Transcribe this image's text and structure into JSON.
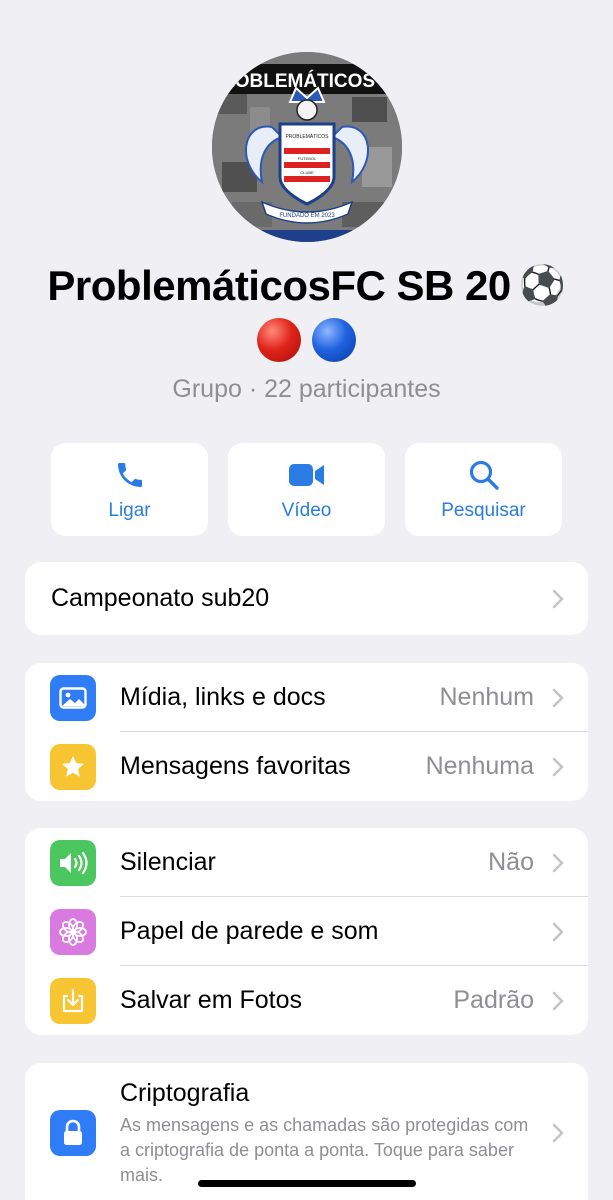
{
  "profile": {
    "name": "ProblemáticosFC SB 20",
    "name_emoji": "⚽",
    "subtitle": "Grupo · 22 participantes",
    "crest_texts": [
      "PROBLEMÁTICOS FC",
      "PROBLEMÁTICOS",
      "FUTEBOL",
      "CLUBE",
      "FUNDADO EM 2023"
    ]
  },
  "actions": [
    {
      "label": "Ligar",
      "icon": "phone-icon"
    },
    {
      "label": "Vídeo",
      "icon": "video-icon"
    },
    {
      "label": "Pesquisar",
      "icon": "search-icon"
    }
  ],
  "description": {
    "text": "Campeonato sub20"
  },
  "media_section": [
    {
      "label": "Mídia, links e docs",
      "value": "Nenhum",
      "icon": "photo-icon",
      "color": "#2f7cf6"
    },
    {
      "label": "Mensagens favoritas",
      "value": "Nenhuma",
      "icon": "star-icon",
      "color": "#f7c531"
    }
  ],
  "settings_section": [
    {
      "label": "Silenciar",
      "value": "Não",
      "icon": "speaker-icon",
      "color": "#4cc760"
    },
    {
      "label": "Papel de parede e som",
      "value": "",
      "icon": "flower-icon",
      "color": "#d97ae0"
    },
    {
      "label": "Salvar em Fotos",
      "value": "Padrão",
      "icon": "download-icon",
      "color": "#f7c531"
    }
  ],
  "encryption": {
    "label": "Criptografia",
    "text": "As mensagens e as chamadas são protegidas com a criptografia de ponta a ponta. Toque para saber mais.",
    "icon": "lock-icon",
    "color": "#2f7cf6"
  },
  "colors": {
    "accent": "#2a7be4",
    "background": "#efeff4"
  }
}
